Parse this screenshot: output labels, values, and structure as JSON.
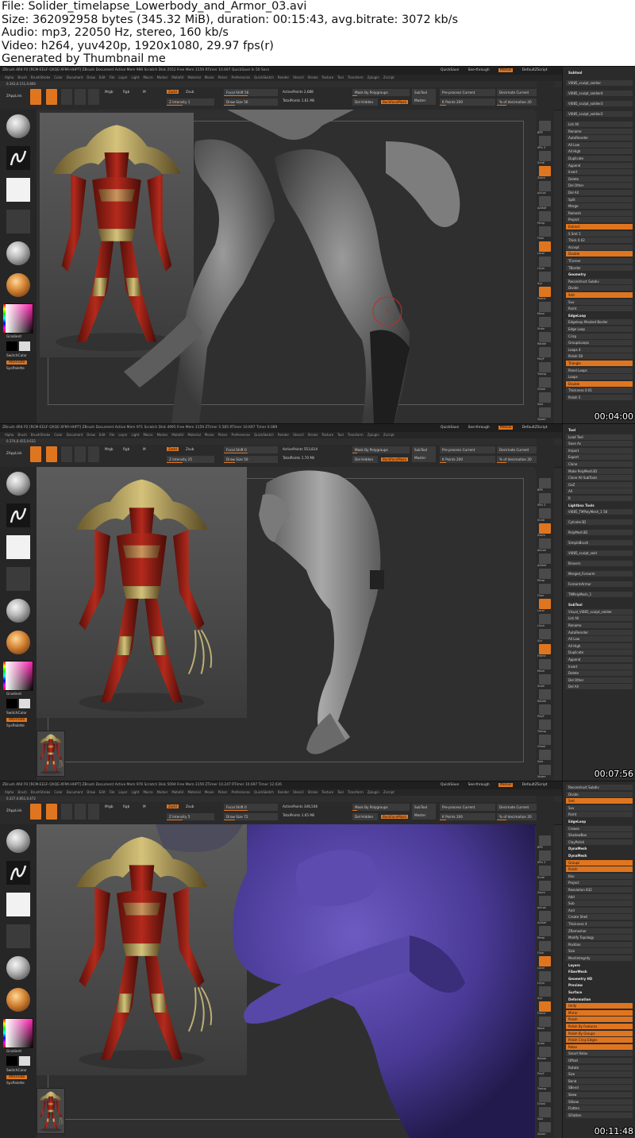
{
  "header": {
    "lines": [
      "File: Solider_timelapse_Lowerbody_and_Armor_03.avi",
      "Size: 362092958 bytes (345.32 MiB), duration: 00:15:43, avg.bitrate: 3072 kb/s",
      "Audio: mp3, 22050 Hz, stereo, 160 kb/s",
      "Video: h264, yuv420p, 1920x1080, 29.97 fps(r)",
      "Generated by Thumbnail me"
    ]
  },
  "menu": {
    "items": [
      "Alpha",
      "Brush",
      "BrushStroke",
      "Color",
      "Document",
      "Draw",
      "Edit",
      "File",
      "Layer",
      "Light",
      "Macro",
      "Marker",
      "MatalUI",
      "Material",
      "Movie",
      "Picker",
      "Preferences",
      "QuickSketch",
      "Render",
      "Stencil",
      "Stroke",
      "Texture",
      "Tool",
      "Transform",
      "Zplugin",
      "Zscript"
    ],
    "quicksave": "QuickSave",
    "seethrough": "See-through",
    "menus": "Menus",
    "defaultscript": "DefaultZScript"
  },
  "toolbar": {
    "applink": "ZAppLink",
    "edit": "Edit",
    "draw": "Draw",
    "move": "Move",
    "scale": "Scale",
    "rotate": "Rotate",
    "mrgb": "Mrgb",
    "rgb": "Rgb",
    "m": "M",
    "zadd": "Zadd",
    "zsub": "Zsub",
    "focal_shift": "Focal Shift",
    "draw_size": "Draw Size",
    "active_points": "ActivePoints",
    "total_points": "TotalPoints",
    "mask_polygroups": "Mask By Polygroups",
    "del_hidden": "Del Hidden",
    "backface": "BackfaceMask",
    "subtool_master": "SubTool Master",
    "preprocess": "Pre-process Current",
    "decimate": "Decimate Current"
  },
  "frames": [
    {
      "status": "ZBrush 4R4 P2 [RCM-EELF-QXQE-XFMI-HHPT]   ZBrush Document   Active Mem 996  Scratch Disk 2552  Free Mem 3159  RTimer 10.697  QuickSave In 50 Secs",
      "coords": "0.263,0.151,0.806",
      "intensity": "Z Intensity 1",
      "focal_value": "Focal Shift 56",
      "draw_size_value": "Draw Size 56",
      "active_points_value": "ActivePoints 2,688",
      "total_points_value": "TotalPoints 1.61 Mil",
      "kpoints": "K Points 200",
      "decimation": "% of decimation 20",
      "timestamp": "00:04:00",
      "panel": [
        "Subtool",
        "VI085_sculpt_soldier",
        "VI085_sculpt_soldier4",
        "VI085_sculpt_soldier3",
        "VI085_sculpt_soldier2",
        "List All",
        "Rename",
        "AutoReorder",
        "All Low",
        "All High",
        "Duplicate",
        "Append",
        "Insert",
        "Delete",
        "Del Other",
        "Del All",
        "Split",
        "Merge",
        "Remesh",
        "Project",
        "Extract",
        "S Smt 5",
        "Thick 0.02",
        "Accept",
        "Double",
        "TCorner",
        "TBorder",
        "Geometry",
        "Reconstruct Subdiv",
        "Divide",
        "Smt",
        "Suv",
        "Rsmt",
        "EdgeLoop",
        "Edgeloop Masked Border",
        "Edge Loop",
        "Crisp",
        "GroupsLoops",
        "Loops 4",
        "Polish 58",
        "Triangle",
        "Panel Loops",
        "Loops",
        "Double",
        "Thickness 0.01",
        "Polish 5"
      ]
    },
    {
      "status": "ZBrush 4R4 P2 [RCM-EELF-QXQE-XFMI-HHPT]   ZBrush Document   Active Mem 971  Scratch Disk 4995  Free Mem 3159  ZTimer 5.585  RTimer 10.697  Timer 0.089",
      "coords": "0.374,0.455,0.632",
      "intensity": "Z Intensity 25",
      "focal_value": "Focal Shift 0",
      "draw_size_value": "Draw Size 50",
      "active_points_value": "ActivePoints 553,814",
      "total_points_value": "TotalPoints 1.70 Mil",
      "kpoints": "K Points 200",
      "decimation": "% of decimation 20",
      "timestamp": "00:07:56",
      "panel": [
        "Tool",
        "Load Tool",
        "Save As",
        "Import",
        "Export",
        "Clone",
        "Make PolyMesh3D",
        "Clone All SubTools",
        "GoZ",
        "All",
        "R",
        "Lightbox Tools",
        "VI085_TMPolyMesh_1 58",
        "Cylinder3D",
        "PolyMesh3D",
        "SimpleBrush",
        "VI085_sculpt_sold",
        "Bravers",
        "Merged_Forearm",
        "ForearmArmor",
        "TMPolyMesh_1",
        "SubTool",
        "Visual_VI085_sculpt_soldier",
        "List All",
        "Rename",
        "AutoReorder",
        "All Low",
        "All High",
        "Duplicate",
        "Append",
        "Insert",
        "Delete",
        "Del Other",
        "Del All"
      ]
    },
    {
      "status": "ZBrush 4R4 P2 [RCM-EELF-QXQE-XFMI-HHPT]   ZBrush Document   Active Mem 976  Scratch Disk 5094  Free Mem 3159  ZTimer 10.247  RTimer 10.697  Timer 12.026",
      "coords": "0.227,0.851,0.472",
      "intensity": "Z Intensity 5",
      "focal_value": "Focal Shift 0",
      "draw_size_value": "Draw Size 72",
      "active_points_value": "ActivePoints 346,546",
      "total_points_value": "TotalPoints 1.65 Mil",
      "kpoints": "K Points 200",
      "decimation": "% of decimation 20",
      "timestamp": "00:11:48",
      "panel": [
        "Reconstruct Subdiv",
        "Divide",
        "Smt",
        "Suv",
        "Rsmt",
        "EdgeLoop",
        "Crease",
        "ShadowBox",
        "ClayPolish",
        "DynaMesh",
        "DynaMesh",
        "Groups",
        "Polish",
        "Blur",
        "Project",
        "Resolution 832",
        "Add",
        "Sub",
        "And",
        "Create Shell",
        "Thickness 4",
        "ZRemesher",
        "Modify Topology",
        "Position",
        "Size",
        "MeshIntegrity",
        "Layers",
        "FiberMesh",
        "Geometry HD",
        "Preview",
        "Surface",
        "Deformation",
        "Unify",
        "Mirror",
        "Polish",
        "Polish By Features",
        "Polish By Groups",
        "Polish Crisp Edges",
        "Relax",
        "Smart Relax",
        "Offset",
        "Rotate",
        "Size",
        "Bend",
        "SBend",
        "Skew",
        "SSkew",
        "Flatten",
        "SFlatten"
      ]
    }
  ],
  "tray": {
    "gradient": "Gradient",
    "switchcolor": "SwitchColor",
    "alternate": "Alternate",
    "syspalette": "SysPalette"
  },
  "shelf": [
    "BPR",
    "SPix 3",
    "Scroll",
    "Zoom",
    "Actual",
    "AAHalf",
    "Persp",
    "Floor",
    "Local",
    "LSym",
    "Xyz",
    "Frame",
    "Move",
    "Scale",
    "Rotate",
    "PolyF",
    "Transp",
    "Ghost",
    "Solo",
    "Xpose"
  ],
  "colors": {
    "accent": "#e0751f",
    "ui_bg": "#2e2e2e",
    "purple_mesh": "#4a3a96"
  }
}
